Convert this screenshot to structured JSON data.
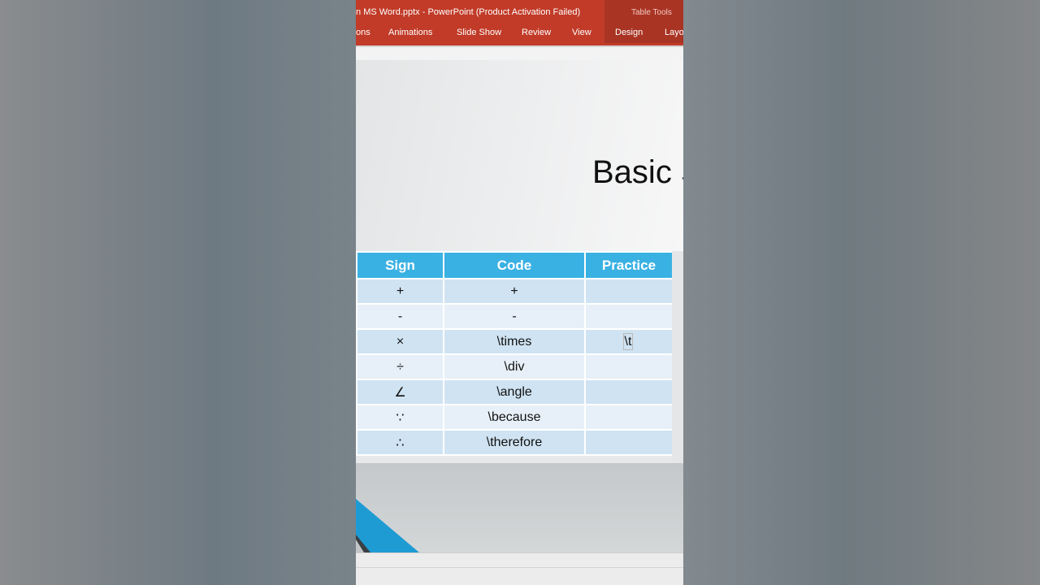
{
  "window": {
    "title": "MS Word.pptx - PowerPoint (Product Activation Failed)",
    "title_prefix_cut": "n",
    "contextual_label": "Table Tools"
  },
  "tabs": [
    {
      "label": "ons"
    },
    {
      "label": "Animations"
    },
    {
      "label": "Slide Show"
    },
    {
      "label": "Review"
    },
    {
      "label": "View"
    },
    {
      "label": "Design"
    },
    {
      "label": "Layo"
    }
  ],
  "slide": {
    "title": "Basic S"
  },
  "table": {
    "headers": [
      "Sign",
      "Code",
      "Practice"
    ],
    "rows": [
      {
        "sign": "+",
        "code": "+",
        "practice": ""
      },
      {
        "sign": "-",
        "code": "-",
        "practice": ""
      },
      {
        "sign": "×",
        "code": "\\times",
        "practice": "\\t"
      },
      {
        "sign": "÷",
        "code": "\\div",
        "practice": ""
      },
      {
        "sign": "∠",
        "code": "\\angle",
        "practice": ""
      },
      {
        "sign": "∵",
        "code": "\\because",
        "practice": ""
      },
      {
        "sign": "∴",
        "code": "\\therefore",
        "practice": ""
      }
    ]
  },
  "colors": {
    "ribbon": "#c13b28",
    "table_header": "#3ab1e3",
    "row_odd": "#cfe3f2",
    "row_even": "#e7f0f8"
  }
}
